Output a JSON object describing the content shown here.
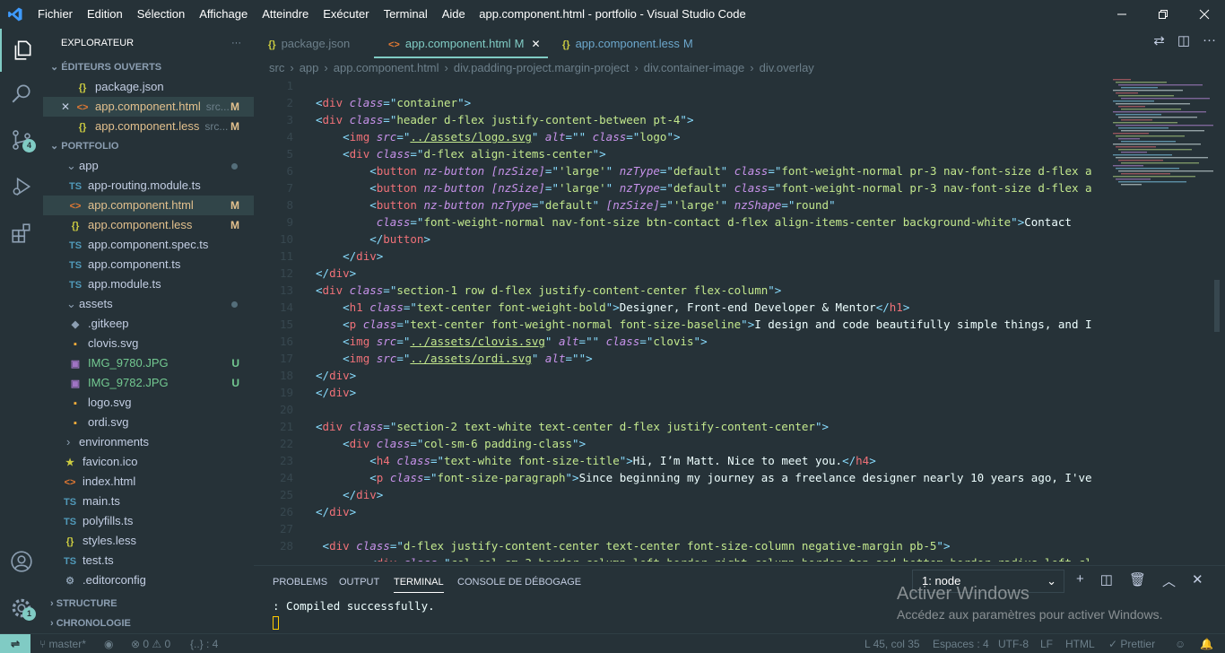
{
  "titlebar": {
    "menu": [
      "Fichier",
      "Edition",
      "Sélection",
      "Affichage",
      "Atteindre",
      "Exécuter",
      "Terminal",
      "Aide"
    ],
    "title": "app.component.html - portfolio - Visual Studio Code"
  },
  "activity": {
    "scm_badge": "4",
    "settings_badge": "1"
  },
  "sidebar": {
    "title": "EXPLORATEUR",
    "open_editors_label": "ÉDITEURS OUVERTS",
    "open_editors": [
      {
        "icon": "{}",
        "name": "package.json",
        "status": ""
      },
      {
        "icon": "<>",
        "name": "app.component.html",
        "path": "src...",
        "status": "M"
      },
      {
        "icon": "{}",
        "name": "app.component.less",
        "path": "src...",
        "status": "M"
      }
    ],
    "project_label": "PORTFOLIO",
    "tree": [
      {
        "type": "folder",
        "name": "app"
      },
      {
        "icon": "TS",
        "name": "app-routing.module.ts",
        "status": ""
      },
      {
        "icon": "<>",
        "name": "app.component.html",
        "status": "M"
      },
      {
        "icon": "{}",
        "name": "app.component.less",
        "status": "M"
      },
      {
        "icon": "TS",
        "name": "app.component.spec.ts",
        "status": ""
      },
      {
        "icon": "TS",
        "name": "app.component.ts",
        "status": ""
      },
      {
        "icon": "TS",
        "name": "app.module.ts",
        "status": ""
      },
      {
        "type": "folder",
        "name": "assets"
      },
      {
        "icon": "◆",
        "name": ".gitkeep",
        "status": ""
      },
      {
        "icon": "▪",
        "name": "clovis.svg",
        "status": ""
      },
      {
        "icon": "▣",
        "name": "IMG_9780.JPG",
        "status": "U"
      },
      {
        "icon": "▣",
        "name": "IMG_9782.JPG",
        "status": "U"
      },
      {
        "icon": "▪",
        "name": "logo.svg",
        "status": ""
      },
      {
        "icon": "▪",
        "name": "ordi.svg",
        "status": ""
      },
      {
        "type": "folder",
        "name": "environments"
      },
      {
        "icon": "★",
        "name": "favicon.ico",
        "status": ""
      },
      {
        "icon": "<>",
        "name": "index.html",
        "status": ""
      },
      {
        "icon": "TS",
        "name": "main.ts",
        "status": ""
      },
      {
        "icon": "TS",
        "name": "polyfills.ts",
        "status": ""
      },
      {
        "icon": "{}",
        "name": "styles.less",
        "status": ""
      },
      {
        "icon": "TS",
        "name": "test.ts",
        "status": ""
      },
      {
        "icon": "⚙",
        "name": ".editorconfig",
        "status": ""
      }
    ],
    "structure_label": "STRUCTURE",
    "timeline_label": "CHRONOLOGIE"
  },
  "tabs": [
    {
      "icon": "{}",
      "name": "package.json",
      "status": ""
    },
    {
      "icon": "<>",
      "name": "app.component.html",
      "status": "M"
    },
    {
      "icon": "{}",
      "name": "app.component.less",
      "status": "M"
    }
  ],
  "breadcrumb": [
    "src",
    "app",
    "app.component.html",
    "div.padding-project.margin-project",
    "div.container-image",
    "div.overlay"
  ],
  "code": {
    "line_numbers": [
      "1",
      "2",
      "3",
      "4",
      "5",
      "6",
      "7",
      "8",
      "9",
      "10",
      "11",
      "12",
      "13",
      "14",
      "15",
      "16",
      "17",
      "18",
      "19",
      "20",
      "21",
      "22",
      "23",
      "24",
      "25",
      "26",
      "27",
      "28"
    ],
    "lines": [
      "",
      "<div class=\"container\">",
      "<div class=\"header d-flex justify-content-between pt-4\">",
      "    <img src=\"../assets/logo.svg\" alt=\"\" class=\"logo\">",
      "    <div class=\"d-flex align-items-center\">",
      "        <button nz-button [nzSize]=\"'large'\" nzType=\"default\" class=\"font-weight-normal pr-3 nav-font-size d-flex a",
      "        <button nz-button [nzSize]=\"'large'\" nzType=\"default\" class=\"font-weight-normal pr-3 nav-font-size d-flex a",
      "        <button nz-button nzType=\"default\" [nzSize]=\"'large'\" nzShape=\"round\"",
      "         class=\"font-weight-normal nav-font-size btn-contact d-flex align-items-center background-white\">Contact",
      "        </button>",
      "    </div>",
      "</div>",
      "<div class=\"section-1 row d-flex justify-content-center flex-column\">",
      "    <h1 class=\"text-center font-weight-bold\">Designer, Front-end Developer & Mentor</h1>",
      "    <p class=\"text-center font-weight-normal font-size-baseline\">I design and code beautifully simple things, and I",
      "    <img src=\"../assets/clovis.svg\" alt=\"\" class=\"clovis\">",
      "    <img src=\"../assets/ordi.svg\" alt=\"\">",
      "</div>",
      "</div>",
      "",
      "<div class=\"section-2 text-white text-center d-flex justify-content-center\">",
      "    <div class=\"col-sm-6 padding-class\">",
      "        <h4 class=\"text-white font-size-title\">Hi, I’m Matt. Nice to meet you.</h4>",
      "        <p class=\"font-size-paragraph\">Since beginning my journey as a freelance designer nearly 10 years ago, I've",
      "    </div>",
      "</div>",
      "",
      " <div class=\"d-flex justify-content-center text-center font-size-column negative-margin pb-5\">"
    ],
    "partial_line": "        <div class=\"col col-sm-3 border-column-left border-right-column border-top-and-bottom border-radius-left cl"
  },
  "panel": {
    "tabs": [
      "PROBLEMS",
      "OUTPUT",
      "TERMINAL",
      "CONSOLE DE DÉBOGAGE"
    ],
    "terminal_select": "1: node",
    "output": ": Compiled successfully."
  },
  "watermark": {
    "title": "Activer Windows",
    "subtitle": "Accédez aux paramètres pour activer Windows."
  },
  "status": {
    "branch": "master*",
    "errors": "0",
    "warnings": "0",
    "braces": "{..} : 4",
    "position": "L 45, col 35",
    "spaces": "Espaces : 4",
    "encoding": "UTF-8",
    "eol": "LF",
    "language": "HTML",
    "formatter": "✓ Prettier"
  },
  "colors": {
    "accent": "#80cbc4",
    "background": "#263238",
    "modified": "#e2c08d",
    "untracked": "#73c991"
  }
}
